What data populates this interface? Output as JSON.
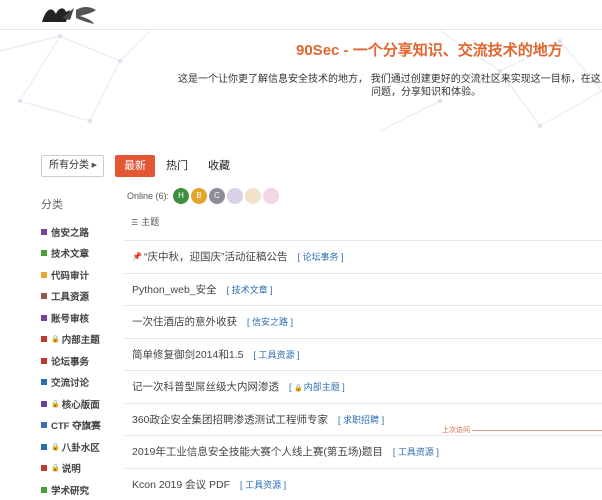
{
  "hero": {
    "title": "90Sec - 一个分享知识、交流技术的地方",
    "desc_line1": "这是一个让你更了解信息安全技术的地方， 我们通过创建更好的交流社区来实现这一目标，在这里你可",
    "desc_line2": "问题，分享知识和体验。"
  },
  "toolbar": {
    "category_button": "所有分类",
    "tabs": [
      "最新",
      "热门",
      "收藏"
    ]
  },
  "sidebar": {
    "heading": "分类",
    "items": [
      {
        "label": "信安之路",
        "color": "#7b3f98",
        "locked": false
      },
      {
        "label": "技术文章",
        "color": "#4a9f3a",
        "locked": false
      },
      {
        "label": "代码审计",
        "color": "#e8a530",
        "locked": false
      },
      {
        "label": "工具资源",
        "color": "#8d5b3a",
        "locked": false
      },
      {
        "label": "账号审核",
        "color": "#7b3f98",
        "locked": false
      },
      {
        "label": "内部主题",
        "color": "#c0392b",
        "locked": true
      },
      {
        "label": "论坛事务",
        "color": "#c0392b",
        "locked": false
      },
      {
        "label": "交流讨论",
        "color": "#2a6db3",
        "locked": false
      },
      {
        "label": "核心版面",
        "color": "#6b3fa0",
        "locked": true
      },
      {
        "label": "CTF 夺旗赛",
        "color": "#3d6fb0",
        "locked": false
      },
      {
        "label": "八卦水区",
        "color": "#2a6db3",
        "locked": true
      },
      {
        "label": "说明",
        "color": "#c0392b",
        "locked": true
      },
      {
        "label": "学术研究",
        "color": "#4a9f3a",
        "locked": false
      }
    ]
  },
  "online": {
    "label": "Online (6):",
    "avatars": [
      {
        "letter": "H",
        "color": "#3b8f3e"
      },
      {
        "letter": "B",
        "color": "#e0a52b"
      },
      {
        "letter": "C",
        "color": "#8e8e9a"
      },
      {
        "letter": "",
        "color": "#d9d0e8"
      },
      {
        "letter": "",
        "color": "#f1e3c7"
      },
      {
        "letter": "",
        "color": "#f3d6e4"
      }
    ]
  },
  "list_header": "主题",
  "last_visit_label": "上次访问",
  "topics": [
    {
      "title": "“庆中秋，迎国庆”活动征稿公告",
      "tag": "论坛事务",
      "pinned": true,
      "locked": false
    },
    {
      "title": "Python_web_安全",
      "tag": "技术文章",
      "pinned": false,
      "locked": false
    },
    {
      "title": "一次住酒店的意外收获",
      "tag": "信安之路",
      "pinned": false,
      "locked": false
    },
    {
      "title": "简单修复御剑2014和1.5",
      "tag": "工具资源",
      "pinned": false,
      "locked": false
    },
    {
      "title": "记一次科普型屌丝级大内网渗透",
      "tag": "内部主题",
      "pinned": false,
      "locked": true
    },
    {
      "title": "360政企安全集团招聘渗透测试工程师专家",
      "tag": "求职招聘",
      "pinned": false,
      "locked": false
    },
    {
      "title": "2019年工业信息安全技能大赛个人线上赛(第五场)题目",
      "tag": "工具资源",
      "pinned": false,
      "locked": false
    },
    {
      "title": "Kcon 2019 会议 PDF",
      "tag": "工具资源",
      "pinned": false,
      "locked": false
    }
  ]
}
